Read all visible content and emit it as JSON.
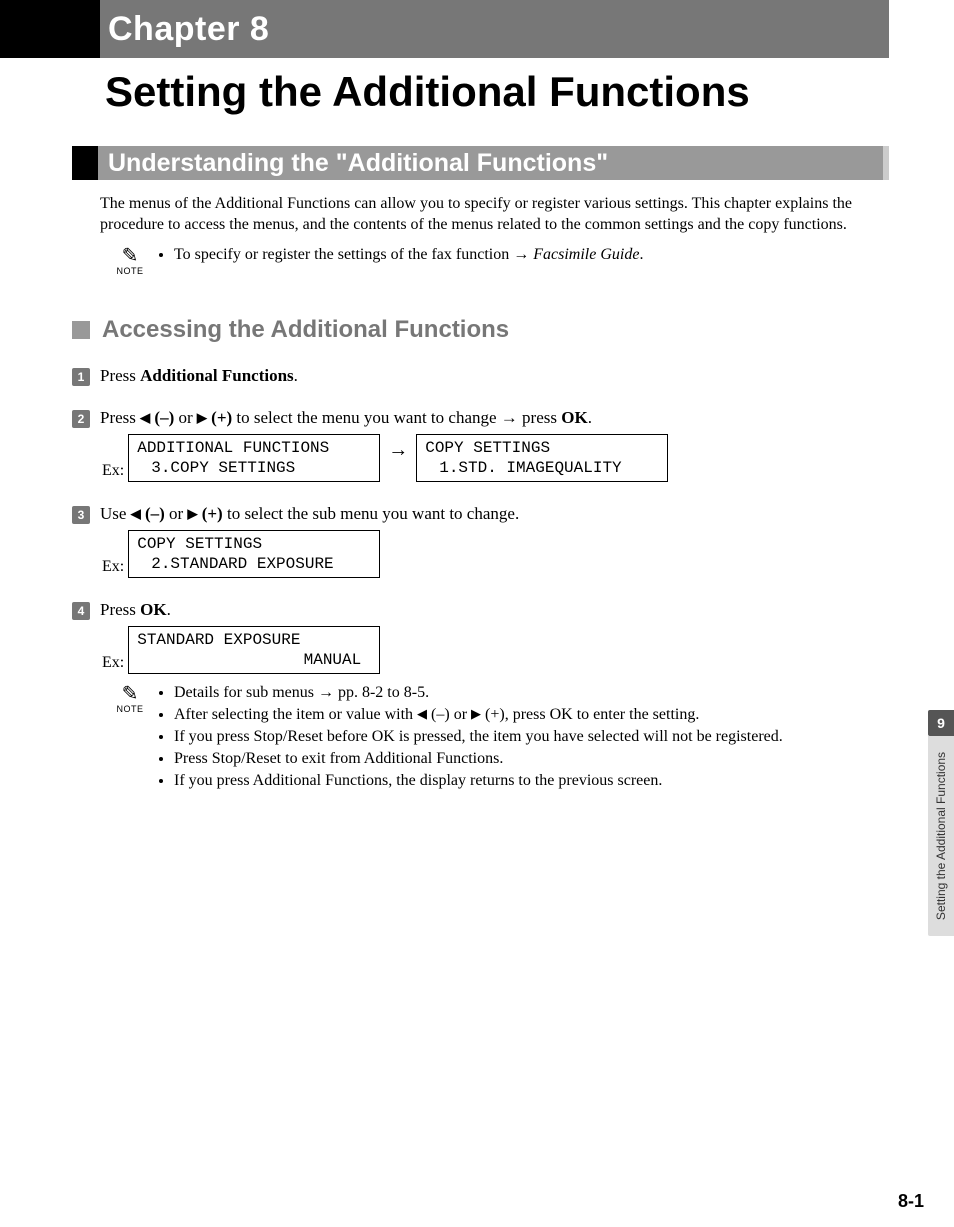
{
  "chapter": {
    "label": "Chapter 8",
    "title": "Setting the Additional Functions"
  },
  "section": {
    "title": "Understanding the \"Additional Functions\"",
    "intro": "The menus of the Additional Functions can allow you to specify or register various settings. This chapter explains the procedure to access the menus, and the contents of the menus related to the common settings and the copy functions."
  },
  "topnote": {
    "label": "NOTE",
    "text_pre": "To specify or register the settings of the fax function → ",
    "text_em": "Facsimile Guide",
    "text_post": "."
  },
  "subhead": "Accessing the Additional Functions",
  "steps": {
    "s1": {
      "num": "1",
      "t_pre": "Press ",
      "t_b": "Additional Functions",
      "t_post": "."
    },
    "s2": {
      "num": "2",
      "t_pre": "Press ",
      "minus": " (–)",
      "or": " or ",
      "plus": " (+)",
      "mid": " to select the menu you want to change → press ",
      "ok": "OK",
      "post": ".",
      "ex_label": "Ex:",
      "lcd1_l1": "ADDITIONAL FUNCTIONS",
      "lcd1_l2": "3.COPY SETTINGS",
      "lcd2_l1": "COPY SETTINGS",
      "lcd2_l2": "1.STD. IMAGEQUALITY"
    },
    "s3": {
      "num": "3",
      "t_pre": "Use ",
      "minus": " (–)",
      "or": " or ",
      "plus": " (+)",
      "post": " to select the sub menu you want to change.",
      "ex_label": "Ex:",
      "lcd_l1": "COPY SETTINGS",
      "lcd_l2": "2.STANDARD EXPOSURE"
    },
    "s4": {
      "num": "4",
      "t_pre": "Press ",
      "ok": "OK",
      "post": ".",
      "ex_label": "Ex:",
      "lcd_l1": "STANDARD EXPOSURE",
      "lcd_l2": "MANUAL"
    }
  },
  "bottomnote": {
    "label": "NOTE",
    "items": {
      "i1": "Details for sub menus → pp. 8-2 to 8-5.",
      "i2_pre": "After selecting the item or value with ",
      "i2_minus": " (–)",
      "i2_or": " or ",
      "i2_plus": " (+)",
      "i2_mid": ", press ",
      "i2_ok": "OK",
      "i2_post": " to enter the setting.",
      "i3_pre": "If you press ",
      "i3_b1": "Stop/Reset",
      "i3_mid": " before ",
      "i3_b2": "OK",
      "i3_post": " is pressed, the item you have selected will not be registered.",
      "i4_pre": "Press ",
      "i4_b": "Stop/Reset",
      "i4_post": " to exit from Additional Functions.",
      "i5_pre": "If you press ",
      "i5_b": "Additional Functions",
      "i5_post": ", the display returns to the previous screen."
    }
  },
  "sidetab": {
    "num": "9",
    "text": "Setting the Additional Functions"
  },
  "pagenum": "8-1",
  "glyphs": {
    "arrow": "→",
    "tri_l": "◀",
    "tri_r": "▶"
  }
}
